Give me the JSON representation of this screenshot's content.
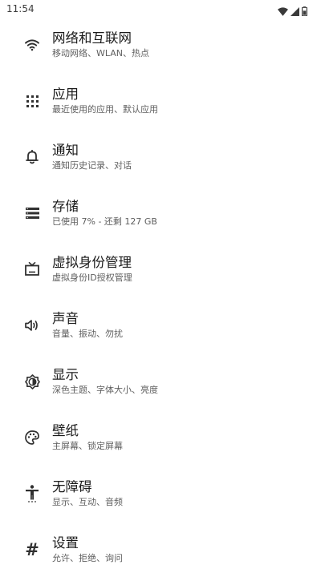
{
  "status_bar": {
    "time": "11:54",
    "icons": [
      "wifi-icon",
      "cellular-signal-icon",
      "battery-icon"
    ]
  },
  "settings": [
    {
      "icon": "wifi-icon",
      "title": "网络和互联网",
      "subtitle": "移动网络、WLAN、热点"
    },
    {
      "icon": "apps-grid-icon",
      "title": "应用",
      "subtitle": "最近使用的应用、默认应用"
    },
    {
      "icon": "bell-icon",
      "title": "通知",
      "subtitle": "通知历史记录、对话"
    },
    {
      "icon": "storage-icon",
      "title": "存储",
      "subtitle": "已使用 7% - 还剩 127 GB"
    },
    {
      "icon": "tv-icon",
      "title": "虚拟身份管理",
      "subtitle": "虚拟身份ID授权管理"
    },
    {
      "icon": "volume-icon",
      "title": "声音",
      "subtitle": "音量、振动、勿扰"
    },
    {
      "icon": "brightness-icon",
      "title": "显示",
      "subtitle": "深色主题、字体大小、亮度"
    },
    {
      "icon": "palette-icon",
      "title": "壁纸",
      "subtitle": "主屏幕、锁定屏幕"
    },
    {
      "icon": "accessibility-icon",
      "title": "无障碍",
      "subtitle": "显示、互动、音频"
    },
    {
      "icon": "hash-icon",
      "title": "设置",
      "subtitle": "允许、拒绝、询问"
    }
  ]
}
